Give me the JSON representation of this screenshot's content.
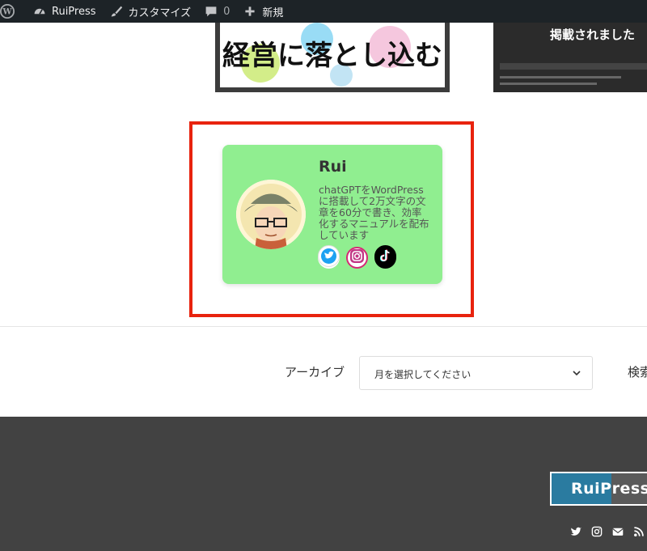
{
  "admin_bar": {
    "site_name": "RuiPress",
    "customize": "カスタマイズ",
    "comments_count": "0",
    "new": "新規"
  },
  "posts": {
    "thumb1_text": "経営に落とし込む",
    "thumb2_caption": "掲載されました"
  },
  "profile": {
    "name": "Rui",
    "bio": "chatGPTをWordPressに搭載して2万文字の文章を60分で書き、効率化するマニュアルを配布しています",
    "social": [
      "twitter-icon",
      "instagram-icon",
      "tiktok-icon"
    ]
  },
  "widgets": {
    "archive_label": "アーカイブ",
    "archive_select_value": "月を選択してください",
    "search_label": "検索"
  },
  "footer": {
    "logo_text": "RuiPress",
    "social": [
      "twitter-icon",
      "instagram-icon",
      "mail-icon",
      "rss-icon"
    ]
  },
  "colors": {
    "admin_bar_bg": "#1d2327",
    "highlight_border": "#e8230e",
    "card_bg": "#90ee90",
    "footer_bg": "#424242"
  }
}
